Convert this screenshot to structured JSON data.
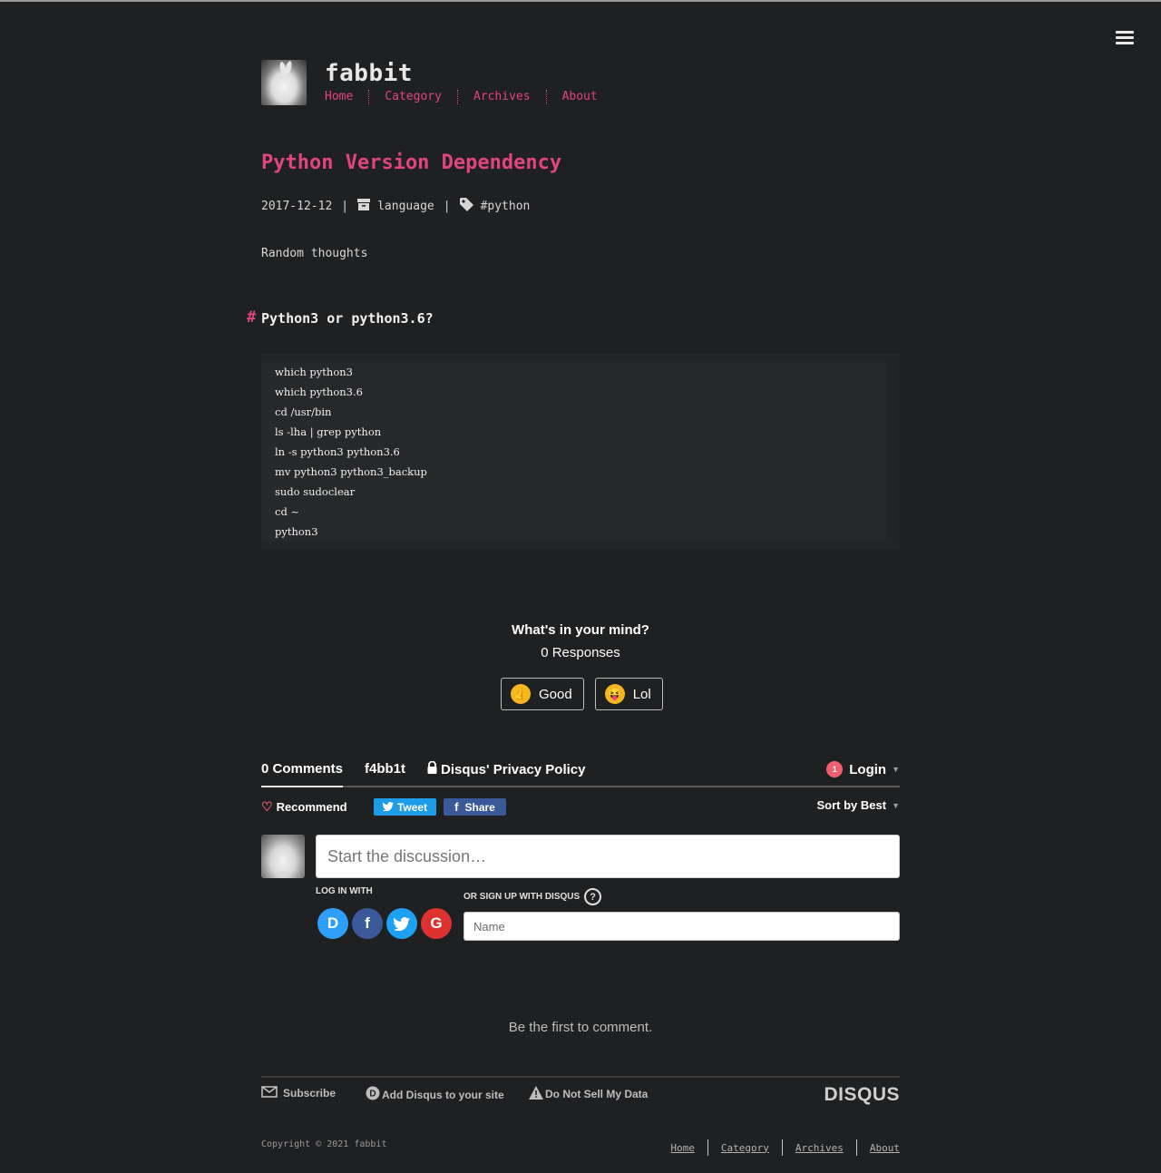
{
  "header": {
    "site_title": "fabbit",
    "nav": [
      "Home",
      "Category",
      "Archives",
      "About"
    ]
  },
  "post": {
    "title": "Python Version Dependency",
    "date": "2017-12-12",
    "category": "language",
    "tag": "#python",
    "excerpt": "Random thoughts",
    "section_heading": "Python3 or python3.6?",
    "hash_mark": "#",
    "code_lines": [
      "which python3",
      "which python3.6",
      "cd /usr/bin",
      "ls -lha | grep python",
      "ln -s python3 python3.6",
      "mv python3 python3_backup",
      "sudo sudoclear",
      "cd ~",
      "python3"
    ]
  },
  "reactions": {
    "title": "What's in your mind?",
    "count_text": "0 Responses",
    "good_label": "Good",
    "lol_label": "Lol"
  },
  "comments": {
    "tab_comments": "0 Comments",
    "tab_forum": "f4bb1t",
    "tab_privacy": "Disqus' Privacy Policy",
    "login_label": "Login",
    "notification_count": "1",
    "recommend_label": "Recommend",
    "tweet_label": "Tweet",
    "share_label": "Share",
    "sort_label": "Sort by Best",
    "input_placeholder": "Start the discussion…",
    "log_in_with": "LOG IN WITH",
    "sign_up_with": "OR SIGN UP WITH DISQUS",
    "name_placeholder": "Name",
    "empty_text": "Be the first to comment.",
    "footer_subscribe": "Subscribe",
    "footer_add": "Add Disqus to your site",
    "footer_dnsmd": "Do Not Sell My Data",
    "brand": "DISQUS",
    "social_icons": [
      "disqus-icon",
      "facebook-icon",
      "twitter-icon",
      "google-icon"
    ]
  },
  "footer": {
    "copyright": "Copyright © 2021 fabbit",
    "nav": [
      "Home",
      "Category",
      "Archives",
      "About"
    ]
  },
  "colors": {
    "background": "#1f2022",
    "accent": "#e0457b",
    "tweet": "#1d9ce8",
    "share": "#3b5998"
  }
}
